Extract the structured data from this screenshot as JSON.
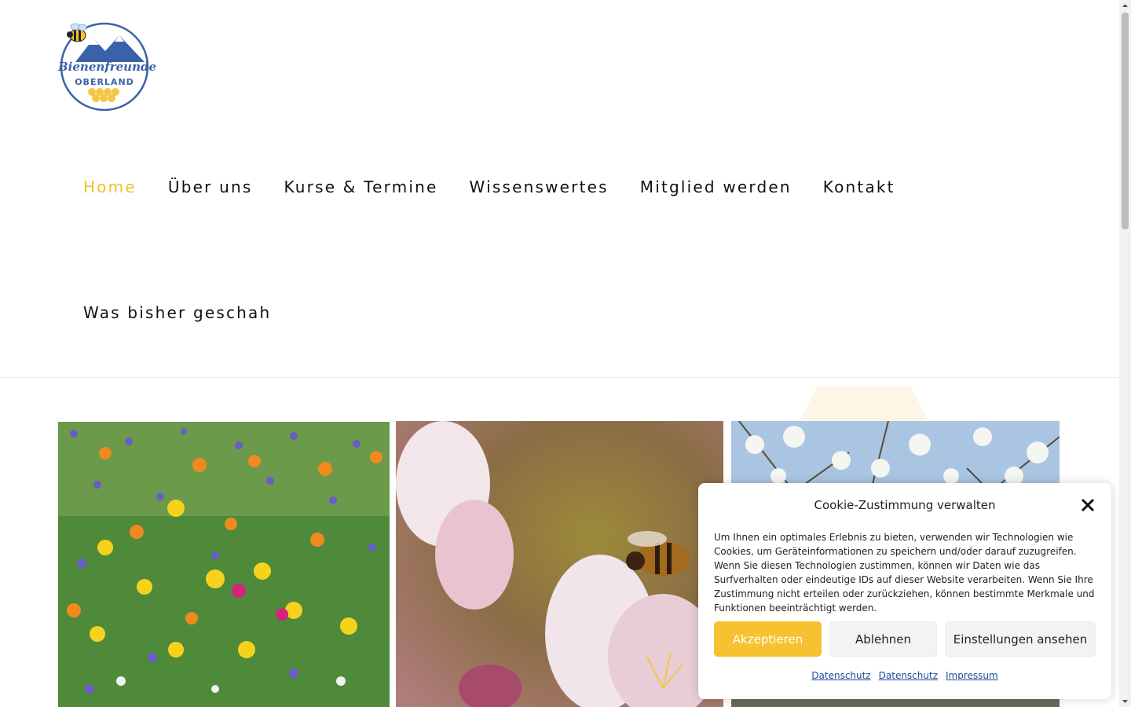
{
  "logo": {
    "line1": "Bienenfreunde",
    "line2": "OBERLAND"
  },
  "nav": {
    "items": [
      {
        "label": "Home",
        "active": true
      },
      {
        "label": "Über uns",
        "active": false
      },
      {
        "label": "Kurse & Termine",
        "active": false
      },
      {
        "label": "Wissenswertes",
        "active": false
      },
      {
        "label": "Mitglied werden",
        "active": false
      },
      {
        "label": "Kontakt",
        "active": false
      }
    ]
  },
  "subtitle": "Was bisher geschah",
  "colors": {
    "accent": "#f2c12e",
    "button_accent": "#f6c230",
    "link": "#1e4a9b"
  },
  "gallery": [
    {
      "subject": "wildflower-meadow"
    },
    {
      "subject": "bee-on-apple-blossom"
    },
    {
      "subject": "blossoming-tree"
    }
  ],
  "cookie": {
    "title": "Cookie-Zustimmung verwalten",
    "text": "Um Ihnen ein optimales Erlebnis zu bieten, verwenden wir Technologien wie Cookies, um Geräteinformationen zu speichern und/oder darauf zuzugreifen. Wenn Sie diesen Technologien zustimmen, können wir Daten wie das Surfverhalten oder eindeutige IDs auf dieser Website verarbeiten. Wenn Sie Ihre Zustimmung nicht erteilen oder zurückziehen, können bestimmte Merkmale und Funktionen beeinträchtigt werden.",
    "accept": "Akzeptieren",
    "deny": "Ablehnen",
    "settings": "Einstellungen ansehen",
    "links": [
      "Datenschutz",
      "Datenschutz",
      "Impressum"
    ]
  }
}
